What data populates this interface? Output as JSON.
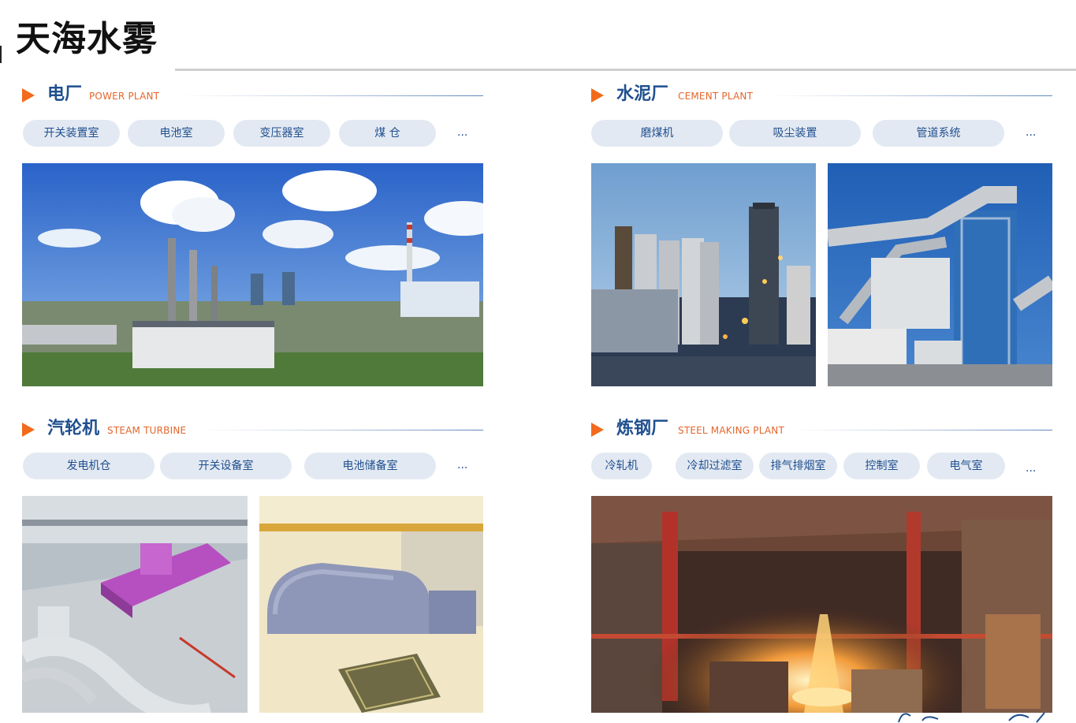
{
  "page": {
    "title": "天海水雾"
  },
  "sections": {
    "power": {
      "title": "电厂",
      "subtitle": "POWER PLANT",
      "tags": [
        "开关装置室",
        "电池室",
        "变压器室",
        "煤 仓"
      ],
      "more": "..."
    },
    "cement": {
      "title": "水泥厂",
      "subtitle": "CEMENT PLANT",
      "tags": [
        "磨煤机",
        "吸尘装置",
        "管道系统"
      ],
      "more": "..."
    },
    "turbine": {
      "title": "汽轮机",
      "subtitle": "STEAM TURBINE",
      "tags": [
        "发电机仓",
        "开关设备室",
        "电池储备室"
      ],
      "more": "..."
    },
    "steel": {
      "title": "炼钢厂",
      "subtitle": "STEEL MAKING PLANT",
      "tags": [
        "冷轧机",
        "冷却过滤室",
        "排气排烟室",
        "控制室",
        "电气室"
      ],
      "more": "..."
    }
  },
  "colors": {
    "accent": "#f26a1b",
    "heading_blue": "#1f4f8f",
    "subtitle_orange": "#e4662b",
    "pill_bg": "#e3e9f2"
  }
}
